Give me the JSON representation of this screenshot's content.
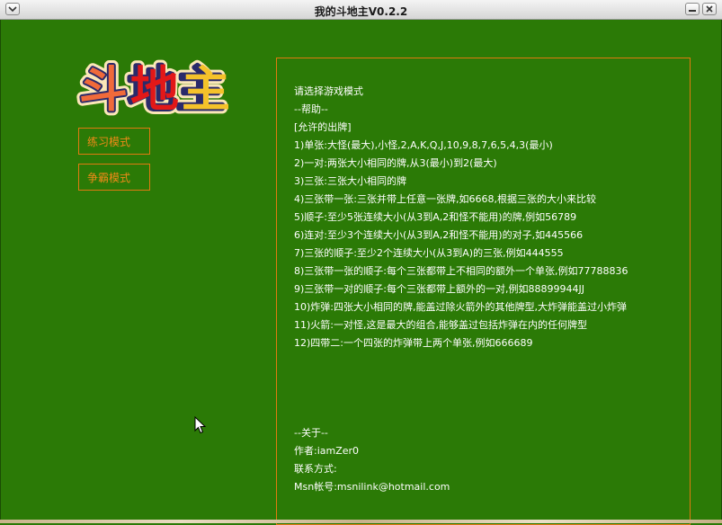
{
  "window": {
    "title": "我的斗地主V0.2.2",
    "controls": [
      "menu",
      "minimize",
      "close"
    ]
  },
  "logo": {
    "text": "斗地主",
    "colors": [
      "#f06a3a",
      "#e21818",
      "#f5c22a"
    ]
  },
  "modes": [
    {
      "label": "练习模式"
    },
    {
      "label": "争霸模式"
    }
  ],
  "info": {
    "select_prompt": "请选择游戏模式",
    "help_heading": "--帮助--",
    "allowed_heading": "[允许的出牌]",
    "rules": [
      "1)单张:大怪(最大),小怪,2,A,K,Q,J,10,9,8,7,6,5,4,3(最小)",
      "2)一对:两张大小相同的牌,从3(最小)到2(最大)",
      "3)三张:三张大小相同的牌",
      "4)三张带一张:三张并带上任意一张牌,如6668,根据三张的大小来比较",
      "5)顺子:至少5张连续大小(从3到A,2和怪不能用)的牌,例如56789",
      "6)连对:至少3个连续大小(从3到A,2和怪不能用)的对子,如445566",
      "7)三张的顺子:至少2个连续大小(从3到A)的三张,例如444555",
      "8)三张带一张的顺子:每个三张都带上不相同的额外一个单张,例如77788836",
      "9)三张带一对的顺子:每个三张都带上额外的一对,例如88899944JJ",
      "10)炸弹:四张大小相同的牌,能盖过除火箭外的其他牌型,大炸弹能盖过小炸弹",
      "11)火箭:一对怪,这是最大的组合,能够盖过包括炸弹在内的任何牌型",
      "12)四带二:一个四张的炸弹带上两个单张,例如666689"
    ],
    "about_heading": "--关于--",
    "author": "作者:iamZer0",
    "contact": "联系方式:",
    "msn": "Msn帐号:msnilink@hotmail.com"
  },
  "colors": {
    "background": "#2b7a06",
    "accent": "#e07a10",
    "text": "#ffffff"
  }
}
